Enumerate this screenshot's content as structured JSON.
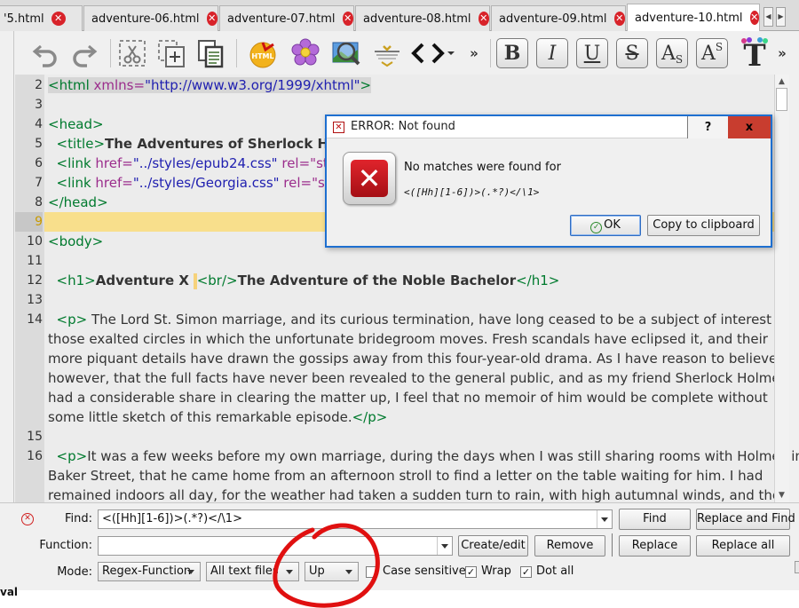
{
  "tabs": [
    {
      "label": "'5.html",
      "active": false
    },
    {
      "label": "adventure-06.html",
      "active": false
    },
    {
      "label": "adventure-07.html",
      "active": false
    },
    {
      "label": "adventure-08.html",
      "active": false
    },
    {
      "label": "adventure-09.html",
      "active": false
    },
    {
      "label": "adventure-10.html",
      "active": true
    }
  ],
  "toolbar": {
    "undo_icon": "undo-icon",
    "redo_icon": "redo-icon",
    "cut_icon": "cut-icon",
    "paste_icon": "paste-icon",
    "copy_icon": "copy-icon",
    "html_validate_label": "HTML",
    "overflow_glyph": "»",
    "bold_label": "B",
    "italic_label": "I",
    "underline_label": "U",
    "strike_label": "S",
    "subscript_label": "A",
    "subscript_sub": "S",
    "superscript_label": "A",
    "superscript_sup": "S",
    "code_glyph": "<>",
    "text_glyph": "T"
  },
  "editor": {
    "lines": [
      {
        "num": "2"
      },
      {
        "num": "3"
      },
      {
        "num": "4"
      },
      {
        "num": "5"
      },
      {
        "num": "6"
      },
      {
        "num": "7"
      },
      {
        "num": "8"
      },
      {
        "num": "9"
      },
      {
        "num": "10"
      },
      {
        "num": "11"
      },
      {
        "num": "12"
      },
      {
        "num": "13"
      },
      {
        "num": "14"
      },
      {
        "num": "15"
      },
      {
        "num": "16"
      }
    ],
    "code": {
      "l2_open": "<html ",
      "l2_attr": "xmlns=",
      "l2_val": "\"http://www.w3.org/1999/xhtml\"",
      "l2_close": ">",
      "l4": "<head>",
      "l5_tag": "<title>",
      "l5_text": "The Adventures of Sherlock Holme",
      "l6_tag": "<link ",
      "l6_attr": "href=",
      "l6_val": "\"../styles/epub24.css\"",
      "l6_attr2": " rel=\"style",
      "l7_tag": "<link ",
      "l7_attr": "href=",
      "l7_val": "\"../styles/Georgia.css\"",
      "l7_attr2": " rel=\"style",
      "l8": "</head>",
      "l10": "<body>",
      "l12_open": "<h1>",
      "l12_text1": "Adventure X",
      "l12_br": "<br/>",
      "l12_text2": "The Adventure of the Noble Bachelor",
      "l12_close": "</h1>",
      "l14_open": "<p>",
      "l14_1": " The Lord St. Simon marriage, and its curious termination, have long ceased to be a subject of interest in",
      "l14_2": "those exalted circles in which the unfortunate bridegroom moves. Fresh scandals have eclipsed it, and their",
      "l14_3": "more piquant details have drawn the gossips away from this four-year-old drama. As I have reason to believe,",
      "l14_4": "however, that the full facts have never been revealed to the general public, and as my friend Sherlock Holmes",
      "l14_5": "had a considerable share in clearing the matter up, I feel that no memoir of him would be complete without",
      "l14_6": "some little sketch of this remarkable episode.",
      "l14_close": "</p>",
      "l16_open": "<p>",
      "l16_1": "It was a few weeks before my own marriage, during the days when I was still sharing rooms with Holmes in",
      "l16_2": "Baker Street, that he came home from an afternoon stroll to find a letter on the table waiting for him. I had",
      "l16_3": "remained indoors all day, for the weather had taken a sudden turn to rain, with high autumnal winds, and the"
    }
  },
  "dialog": {
    "title": "ERROR: Not found",
    "help_label": "?",
    "close_label": "x",
    "message": "No matches were found for",
    "pattern": "<([Hh][1-6])>(.*?)</\\1>",
    "ok_label": "OK",
    "copy_label": "Copy to clipboard"
  },
  "find_panel": {
    "find_label": "Find:",
    "find_value": "<([Hh][1-6])>(.*?)</\\1>",
    "function_label": "Function:",
    "function_value": "",
    "mode_label": "Mode:",
    "mode_value": "Regex-Function",
    "scope_value": "All text files",
    "direction_value": "Up",
    "find_button": "Find",
    "replace_and_find_button": "Replace and Find",
    "create_edit_button": "Create/edit",
    "remove_button": "Remove",
    "replace_button": "Replace",
    "replace_all_button": "Replace all",
    "case_sensitive_label": "Case sensitive",
    "case_sensitive_checked": false,
    "wrap_label": "Wrap",
    "wrap_checked": true,
    "dot_all_label": "Dot all",
    "dot_all_checked": true,
    "check_mark": "✓"
  },
  "bottom_text": "val",
  "colors": {
    "current_line": "#f8df8c",
    "tag_green": "#007a2e",
    "attribute_purple": "#9b2d8c",
    "value_blue": "#2020b0",
    "error_red": "#d8232a",
    "annotation_circle": "#e01010"
  }
}
